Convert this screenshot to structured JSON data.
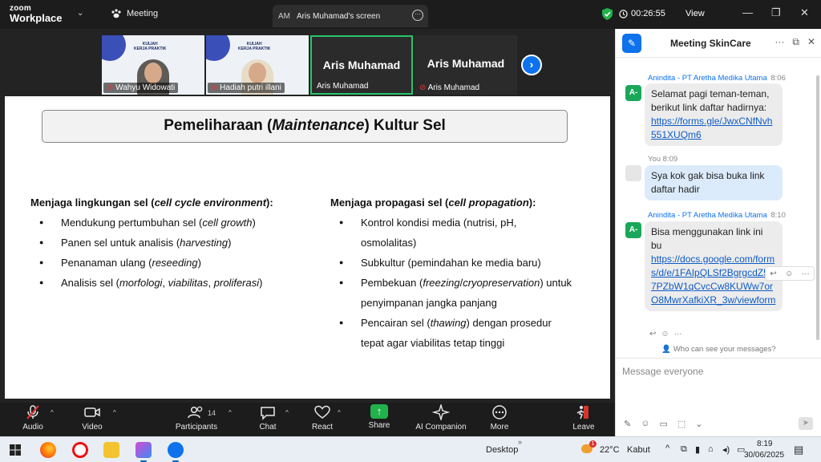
{
  "titlebar": {
    "logo_top": "zoom",
    "logo_bottom": "Workplace",
    "meeting_label": "Meeting",
    "screen_tab_initials": "AM",
    "screen_tab_label": "Aris Muhamad's screen",
    "timer": "00:26:55",
    "view_label": "View",
    "shield_color": "#22b24c"
  },
  "participants": [
    {
      "name": "Wahyu Widowati",
      "type": "video"
    },
    {
      "name": "Hadiah putri illani",
      "type": "video"
    },
    {
      "name": "Aris Muhamad",
      "display": "Aris Muhamad",
      "type": "name",
      "active": true
    },
    {
      "name": "Aris Muhamad",
      "display": "Aris Muhamad",
      "type": "name",
      "muted": true
    }
  ],
  "thumb_banner": {
    "line1": "KULIAH",
    "line2": "KERJA PRAKTIK"
  },
  "slide": {
    "title_pre": "Pemeliharaan (",
    "title_em": "Maintenance",
    "title_post": ") Kultur Sel",
    "left": {
      "head_pre": "Menjaga lingkungan sel (",
      "head_em": "cell cycle environment",
      "head_post": "):",
      "items": [
        {
          "pre": "Mendukung pertumbuhan sel (",
          "em": "cell growth",
          "post": ")"
        },
        {
          "pre": "Panen sel untuk analisis (",
          "em": "harvesting",
          "post": ")"
        },
        {
          "pre": "Penanaman ulang (",
          "em": "reseeding",
          "post": ")"
        },
        {
          "pre": "Analisis sel (",
          "em": "morfologi",
          "mid": ", ",
          "em2": "viabilitas",
          "mid2": ", ",
          "em3": "proliferasi",
          "post": ")"
        }
      ]
    },
    "right": {
      "head_pre": "Menjaga propagasi sel (",
      "head_em": "cell propagation",
      "head_post": "):",
      "items": [
        {
          "line1": "Kontrol kondisi media (nutrisi, pH,",
          "line2": "osmolalitas)"
        },
        {
          "line1": "Subkultur (pemindahan ke media baru)"
        },
        {
          "pre": "Pembekuan (",
          "em": "freezing",
          "mid": "/",
          "em2": "cryopreservation",
          "post": ") untuk",
          "line2": "penyimpanan jangka panjang"
        },
        {
          "pre": "Pencairan sel (",
          "em": "thawing",
          "post": ") dengan prosedur",
          "line2": "tepat agar viabilitas tetap tinggi"
        }
      ]
    }
  },
  "toolbar": {
    "audio": "Audio",
    "video": "Video",
    "participants": "Participants",
    "participants_count": "14",
    "chat": "Chat",
    "react": "React",
    "share": "Share",
    "ai": "AI Companion",
    "more": "More",
    "leave": "Leave"
  },
  "chat": {
    "title": "Meeting SkinCare",
    "messages": [
      {
        "sender": "Anindita - PT Aretha Medika Utama",
        "time": "8:06",
        "avatar": "A-",
        "text": "Selamat pagi teman-teman, berikut link daftar hadirnya:",
        "link": "https://forms.gle/JwxCNfNvh551XUQm6"
      },
      {
        "sender": "You",
        "time": "8:09",
        "text": "Sya kok gak bisa buka link daftar hadir"
      },
      {
        "sender": "Anindita - PT Aretha Medika Utama",
        "time": "8:10",
        "avatar": "A-",
        "text": "Bisa menggunakan link ini bu",
        "link": "https://docs.google.com/forms/d/e/1FAIpQLSf2BgrgcdZ557PZbW1qCvcCw8KUWw7orO8MwrXafkiXR_3w/viewform"
      }
    ],
    "who_can_see": "Who can see your messages?",
    "placeholder": "Message everyone"
  },
  "taskbar": {
    "desktop_label": "Desktop",
    "weather_temp": "22°C",
    "weather_desc": "Kabut",
    "time": "8:19",
    "date": "30/06/2025",
    "weather_badge": "1"
  }
}
